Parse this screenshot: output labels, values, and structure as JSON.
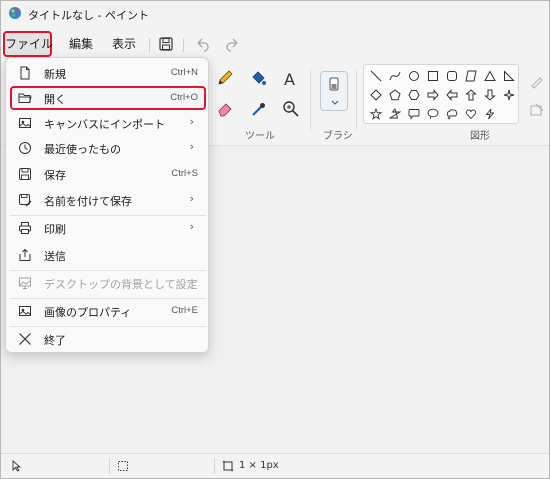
{
  "window": {
    "title": "タイトルなし - ペイント"
  },
  "menubar": {
    "file": "ファイル",
    "edit": "編集",
    "view": "表示"
  },
  "ribbon": {
    "tools_label": "ツール",
    "brush_label": "ブラシ",
    "shapes_label": "図形"
  },
  "file_menu": {
    "items": [
      {
        "label": "新規",
        "shortcut": "Ctrl+N",
        "icon": "new-file-icon"
      },
      {
        "label": "開く",
        "shortcut": "Ctrl+O",
        "icon": "open-folder-icon"
      },
      {
        "label": "キャンバスにインポート",
        "shortcut": "",
        "icon": "import-image-icon",
        "submenu": true
      },
      {
        "label": "最近使ったもの",
        "shortcut": "",
        "icon": "recent-clock-icon",
        "submenu": true
      },
      {
        "label": "保存",
        "shortcut": "Ctrl+S",
        "icon": "save-icon"
      },
      {
        "label": "名前を付けて保存",
        "shortcut": "",
        "icon": "save-as-icon",
        "submenu": true
      },
      {
        "label": "印刷",
        "shortcut": "",
        "icon": "print-icon",
        "submenu": true
      },
      {
        "label": "送信",
        "shortcut": "",
        "icon": "share-icon"
      },
      {
        "label": "デスクトップの背景として設定",
        "shortcut": "",
        "icon": "wallpaper-icon",
        "submenu": true,
        "disabled": true
      },
      {
        "label": "画像のプロパティ",
        "shortcut": "Ctrl+E",
        "icon": "image-properties-icon"
      },
      {
        "label": "終了",
        "shortcut": "",
        "icon": "close-icon"
      }
    ],
    "submenu_arrow": "›"
  },
  "statusbar": {
    "canvas_size": "1 × 1px"
  },
  "colors": {
    "highlight": "#e0142a",
    "accent": "#1f5fa8"
  }
}
